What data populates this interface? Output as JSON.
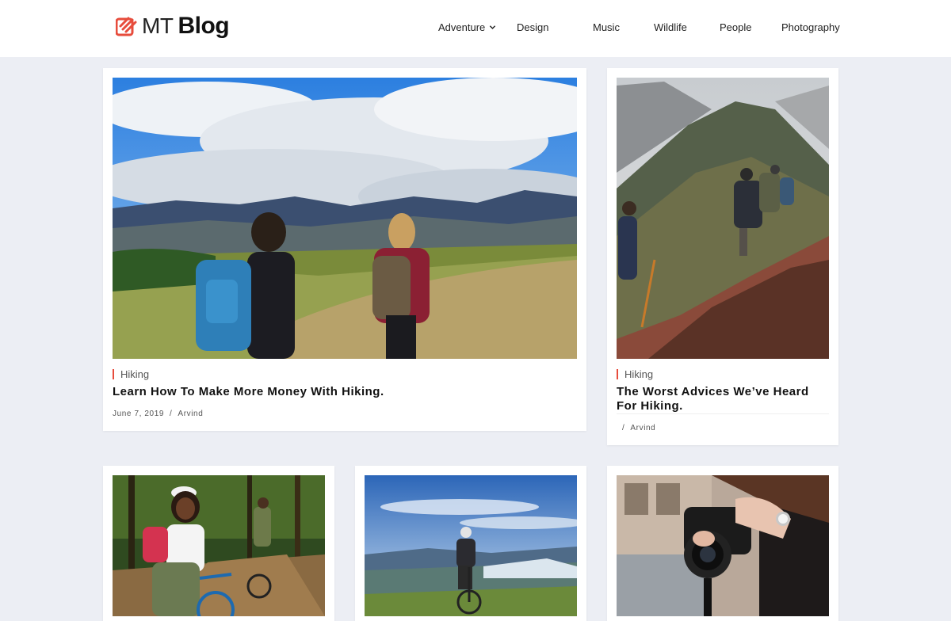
{
  "site": {
    "logo_prefix": "MT",
    "logo_name": "Blog",
    "accent": "#e74c3c"
  },
  "nav": [
    {
      "label": "Adventure",
      "has_dropdown": true
    },
    {
      "label": "Design"
    },
    {
      "label": "Music"
    },
    {
      "label": "Wildlife"
    },
    {
      "label": "People"
    },
    {
      "label": "Photography"
    }
  ],
  "posts": [
    {
      "category": "Hiking",
      "title": "Learn How To Make More Money With Hiking.",
      "date": "June 7, 2019",
      "separator": "/",
      "author": "Arvind",
      "image": "hikers-mountain-meadow"
    },
    {
      "category": "Hiking",
      "title": "The Worst Advices We’ve Heard For Hiking.",
      "date": "",
      "separator": "/",
      "author": "Arvind",
      "image": "hikers-rocky-ridge"
    },
    {
      "image": "woman-with-bicycle-in-forest"
    },
    {
      "image": "cyclist-on-hilltop"
    },
    {
      "image": "hands-holding-camera"
    }
  ]
}
